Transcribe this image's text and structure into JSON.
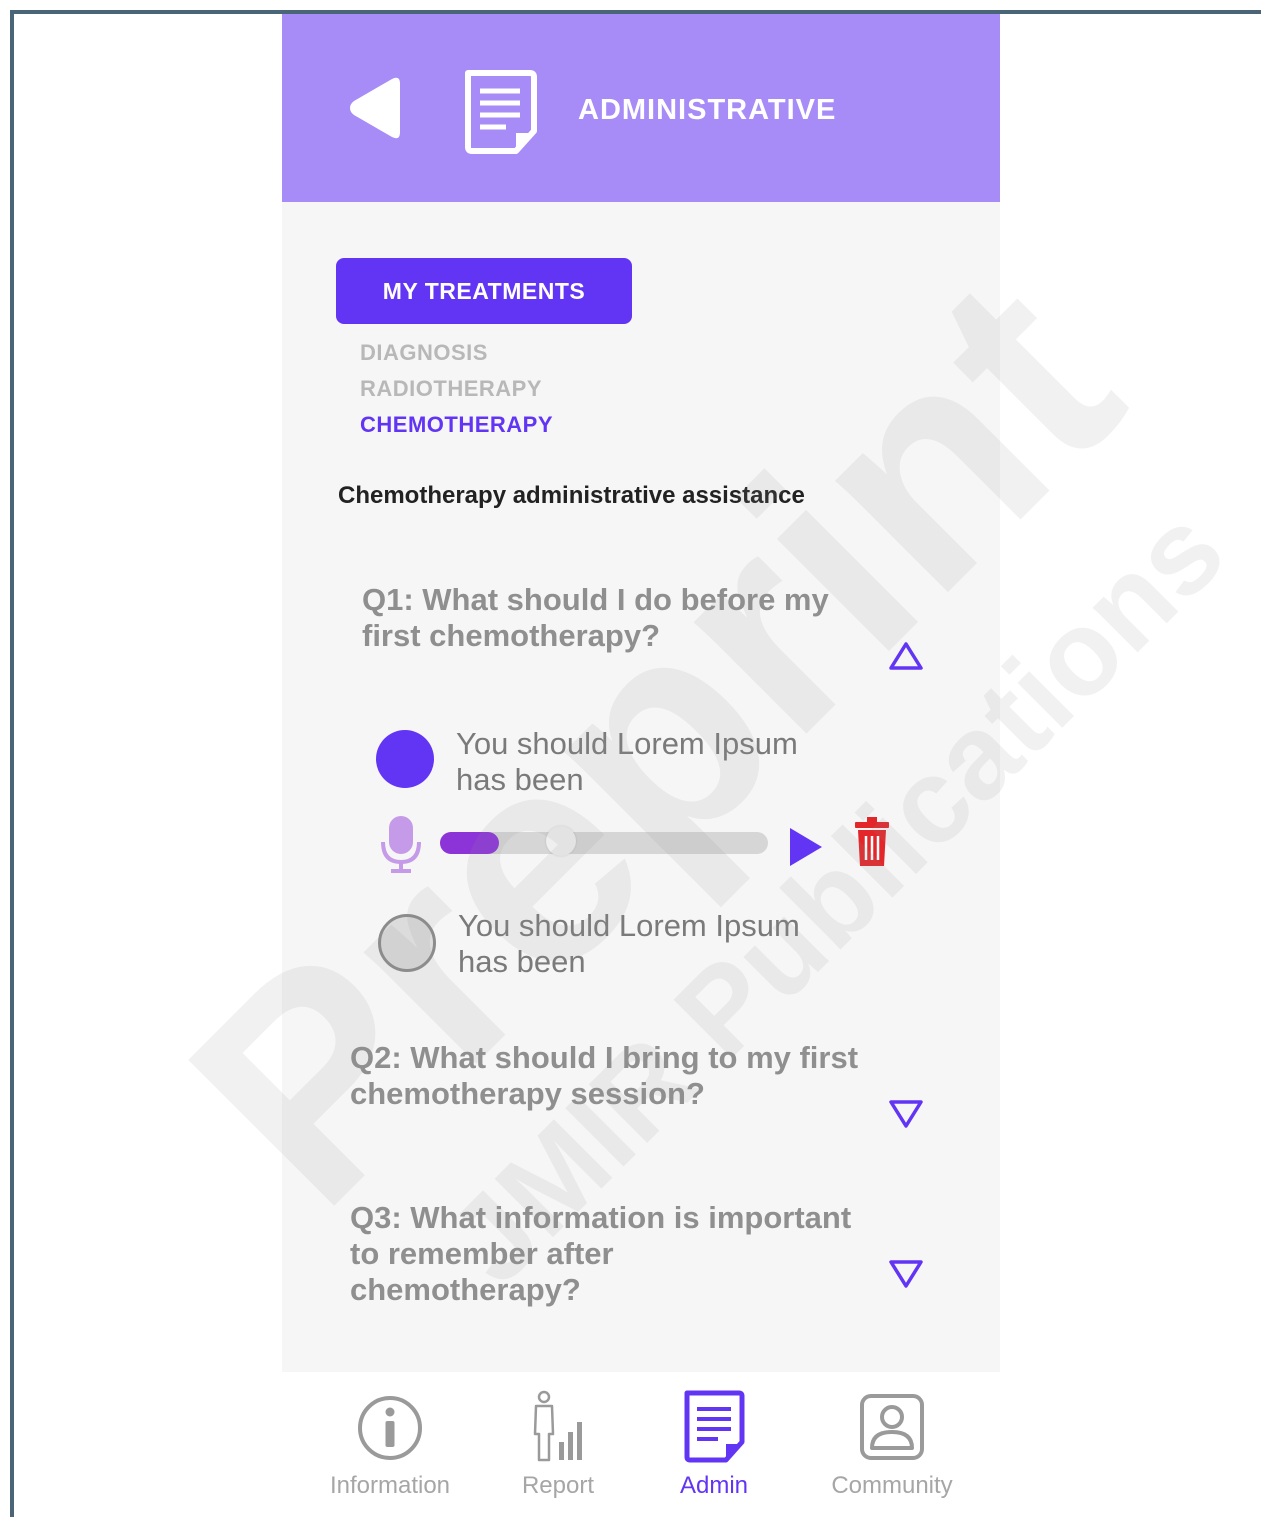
{
  "header": {
    "title": "ADMINISTRATIVE",
    "back_icon": "back-arrow-icon",
    "page_icon": "document-icon",
    "background_color": "#a78bf7"
  },
  "treatments": {
    "button_label": "MY TREATMENTS",
    "items": [
      {
        "label": "DIAGNOSIS",
        "active": false
      },
      {
        "label": "RADIOTHERAPY",
        "active": false
      },
      {
        "label": "CHEMOTHERAPY",
        "active": true
      }
    ]
  },
  "section_title": "Chemotherapy administrative assistance",
  "questions": [
    {
      "line1": "Q1: What should I do before my",
      "line2": "first chemotherapy?",
      "expanded": true,
      "answers": [
        {
          "line1": "You should Lorem Ipsum",
          "line2": "has been",
          "selected": true
        },
        {
          "line1": "You should Lorem Ipsum",
          "line2": "has been",
          "selected": false
        }
      ],
      "audio": {
        "progress": 0.18,
        "position": 0.37
      }
    },
    {
      "line1": "Q2: What should I bring to my first",
      "line2": "chemotherapy session?",
      "expanded": false
    },
    {
      "line1": "Q3: What information is important",
      "line2": "to remember after",
      "line3": "chemotherapy?",
      "expanded": false
    }
  ],
  "tabs": [
    {
      "label": "Information",
      "icon": "info-icon",
      "active": false
    },
    {
      "label": "Report",
      "icon": "report-icon",
      "active": false
    },
    {
      "label": "Admin",
      "icon": "document-icon",
      "active": true
    },
    {
      "label": "Community",
      "icon": "user-icon",
      "active": false
    }
  ],
  "watermark": {
    "line1": "Preprint",
    "line2": "JMIR Publications"
  },
  "colors": {
    "accent": "#6235f5",
    "delete": "#e3262a",
    "mic": "#c59ae8",
    "progress": "#8d34d8"
  }
}
